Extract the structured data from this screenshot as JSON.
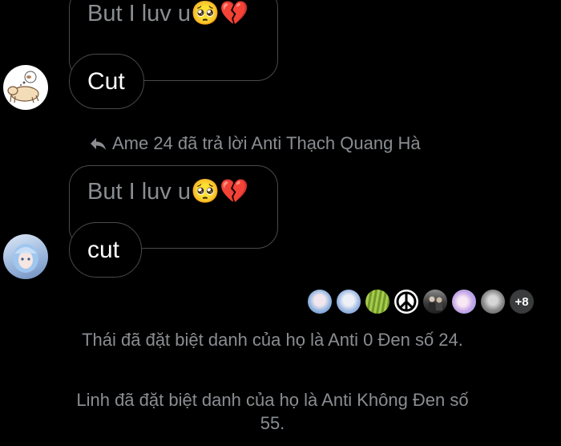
{
  "conversation": {
    "messages": [
      {
        "reply_quote_text": "But I luv u",
        "reply_quote_emoji": "🥺💔",
        "text": "Cut",
        "avatar_icon": "sleeping-dog-avatar"
      },
      {
        "reply_notice": "Ame 24 đã trả lời Anti Thạch Quang Hà",
        "reply_quote_text": "But I luv u",
        "reply_quote_emoji": "🥺💔",
        "text": "cut",
        "avatar_icon": "anime-girl-avatar"
      }
    ],
    "seen_by": {
      "avatar_icons": [
        "anime-avatar",
        "anime-avatar",
        "rice-field-avatar",
        "peace-sign-avatar",
        "group-photo-avatar",
        "pastel-anime-avatar",
        "gray-photo-avatar"
      ],
      "more_count": "+8"
    },
    "system_messages": [
      "Thái đã đặt biệt danh của họ là Anti 0 Đen số 24.",
      "Linh đã đặt biệt danh của họ là Anti Không Đen số 55."
    ]
  },
  "colors": {
    "background": "#000000",
    "bubble_border": "#4a4a4a",
    "muted_text": "#8a8d91",
    "message_text": "#ffffff"
  }
}
